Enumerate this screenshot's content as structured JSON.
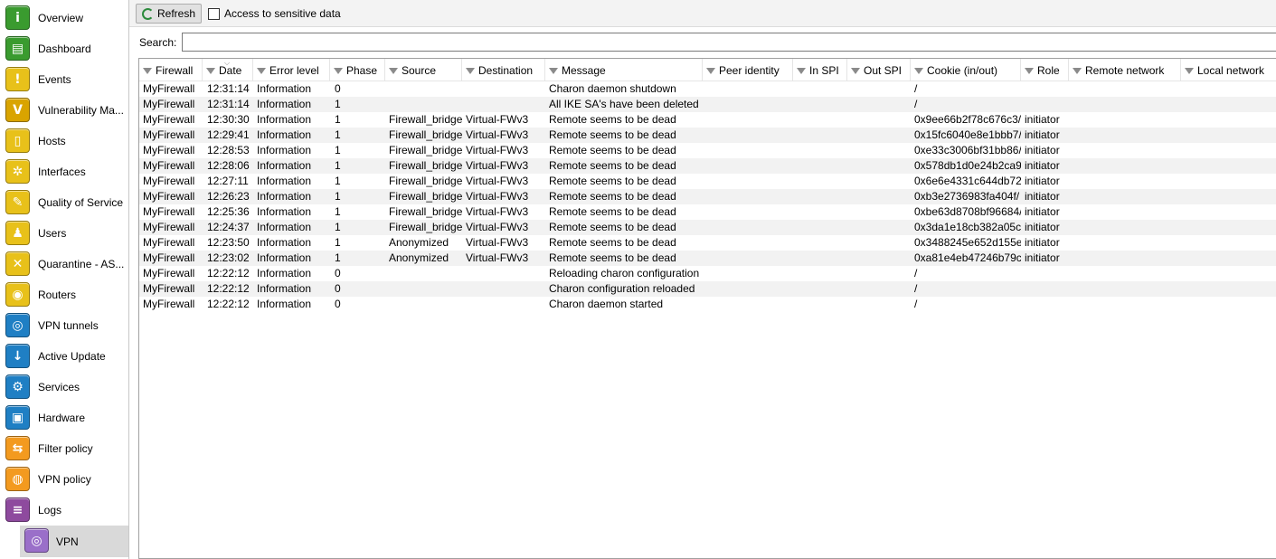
{
  "sidebar": {
    "items": [
      {
        "label": "Overview",
        "icon": "info-icon",
        "glyph": "i",
        "color": "#3a9b2f"
      },
      {
        "label": "Dashboard",
        "icon": "dashboard-icon",
        "glyph": "▤",
        "color": "#3a9b2f"
      },
      {
        "label": "Events",
        "icon": "events-icon",
        "glyph": "!",
        "color": "#e8c11a"
      },
      {
        "label": "Vulnerability Ma...",
        "icon": "vulnerability-icon",
        "glyph": "V",
        "color": "#d9a400"
      },
      {
        "label": "Hosts",
        "icon": "hosts-icon",
        "glyph": "▯",
        "color": "#e8c11a"
      },
      {
        "label": "Interfaces",
        "icon": "interfaces-icon",
        "glyph": "✲",
        "color": "#e8c11a"
      },
      {
        "label": "Quality of Service",
        "icon": "qos-icon",
        "glyph": "✎",
        "color": "#e8c11a"
      },
      {
        "label": "Users",
        "icon": "users-icon",
        "glyph": "♟",
        "color": "#e8c11a"
      },
      {
        "label": "Quarantine - AS...",
        "icon": "quarantine-icon",
        "glyph": "✕",
        "color": "#e8c11a"
      },
      {
        "label": "Routers",
        "icon": "routers-icon",
        "glyph": "◉",
        "color": "#e8c11a"
      },
      {
        "label": "VPN tunnels",
        "icon": "vpn-tunnels-icon",
        "glyph": "◎",
        "color": "#1f7fc4"
      },
      {
        "label": "Active Update",
        "icon": "active-update-icon",
        "glyph": "↓",
        "color": "#1f7fc4"
      },
      {
        "label": "Services",
        "icon": "services-icon",
        "glyph": "⚙",
        "color": "#1f7fc4"
      },
      {
        "label": "Hardware",
        "icon": "hardware-icon",
        "glyph": "▣",
        "color": "#1f7fc4"
      },
      {
        "label": "Filter policy",
        "icon": "filter-policy-icon",
        "glyph": "⇆",
        "color": "#f39a1f"
      },
      {
        "label": "VPN policy",
        "icon": "vpn-policy-icon",
        "glyph": "◍",
        "color": "#f39a1f"
      },
      {
        "label": "Logs",
        "icon": "logs-icon",
        "glyph": "≡",
        "color": "#8e4a9e"
      }
    ],
    "sub_item": {
      "label": "VPN",
      "icon": "vpn-log-icon",
      "glyph": "◎",
      "color": "#9a6fc9"
    }
  },
  "toolbar": {
    "refresh_label": "Refresh",
    "sensitive_label": "Access to sensitive data"
  },
  "search": {
    "label": "Search:",
    "value": "",
    "placeholder": ""
  },
  "table": {
    "columns": [
      "Firewall",
      "Date",
      "Error level",
      "Phase",
      "Source",
      "Destination",
      "Message",
      "Peer identity",
      "In SPI",
      "Out SPI",
      "Cookie (in/out)",
      "Role",
      "Remote network",
      "Local network"
    ],
    "rows": [
      [
        "MyFirewall",
        "12:31:14",
        "Information",
        "0",
        "",
        "",
        "Charon daemon shutdown",
        "",
        "",
        "",
        "/",
        "",
        "",
        ""
      ],
      [
        "MyFirewall",
        "12:31:14",
        "Information",
        "1",
        "",
        "",
        "All IKE SA's have been deleted",
        "",
        "",
        "",
        "/",
        "",
        "",
        ""
      ],
      [
        "MyFirewall",
        "12:30:30",
        "Information",
        "1",
        "Firewall_bridge",
        "Virtual-FWv3",
        "Remote seems to be dead",
        "",
        "",
        "",
        "0x9ee66b2f78c676c3/",
        "initiator",
        "",
        ""
      ],
      [
        "MyFirewall",
        "12:29:41",
        "Information",
        "1",
        "Firewall_bridge",
        "Virtual-FWv3",
        "Remote seems to be dead",
        "",
        "",
        "",
        "0x15fc6040e8e1bbb7/",
        "initiator",
        "",
        ""
      ],
      [
        "MyFirewall",
        "12:28:53",
        "Information",
        "1",
        "Firewall_bridge",
        "Virtual-FWv3",
        "Remote seems to be dead",
        "",
        "",
        "",
        "0xe33c3006bf31bb86/",
        "initiator",
        "",
        ""
      ],
      [
        "MyFirewall",
        "12:28:06",
        "Information",
        "1",
        "Firewall_bridge",
        "Virtual-FWv3",
        "Remote seems to be dead",
        "",
        "",
        "",
        "0x578db1d0e24b2ca9/",
        "initiator",
        "",
        ""
      ],
      [
        "MyFirewall",
        "12:27:11",
        "Information",
        "1",
        "Firewall_bridge",
        "Virtual-FWv3",
        "Remote seems to be dead",
        "",
        "",
        "",
        "0x6e6e4331c644db72/",
        "initiator",
        "",
        ""
      ],
      [
        "MyFirewall",
        "12:26:23",
        "Information",
        "1",
        "Firewall_bridge",
        "Virtual-FWv3",
        "Remote seems to be dead",
        "",
        "",
        "",
        "0xb3e2736983fa404f/",
        "initiator",
        "",
        ""
      ],
      [
        "MyFirewall",
        "12:25:36",
        "Information",
        "1",
        "Firewall_bridge",
        "Virtual-FWv3",
        "Remote seems to be dead",
        "",
        "",
        "",
        "0xbe63d8708bf96684/",
        "initiator",
        "",
        ""
      ],
      [
        "MyFirewall",
        "12:24:37",
        "Information",
        "1",
        "Firewall_bridge",
        "Virtual-FWv3",
        "Remote seems to be dead",
        "",
        "",
        "",
        "0x3da1e18cb382a05c/",
        "initiator",
        "",
        ""
      ],
      [
        "MyFirewall",
        "12:23:50",
        "Information",
        "1",
        "Anonymized",
        "Virtual-FWv3",
        "Remote seems to be dead",
        "",
        "",
        "",
        "0x3488245e652d155e/",
        "initiator",
        "",
        ""
      ],
      [
        "MyFirewall",
        "12:23:02",
        "Information",
        "1",
        "Anonymized",
        "Virtual-FWv3",
        "Remote seems to be dead",
        "",
        "",
        "",
        "0xa81e4eb47246b79c/",
        "initiator",
        "",
        ""
      ],
      [
        "MyFirewall",
        "12:22:12",
        "Information",
        "0",
        "",
        "",
        "Reloading charon configuration",
        "",
        "",
        "",
        "/",
        "",
        "",
        ""
      ],
      [
        "MyFirewall",
        "12:22:12",
        "Information",
        "0",
        "",
        "",
        "Charon configuration reloaded",
        "",
        "",
        "",
        "/",
        "",
        "",
        ""
      ],
      [
        "MyFirewall",
        "12:22:12",
        "Information",
        "0",
        "",
        "",
        "Charon daemon started",
        "",
        "",
        "",
        "/",
        "",
        "",
        ""
      ]
    ]
  }
}
